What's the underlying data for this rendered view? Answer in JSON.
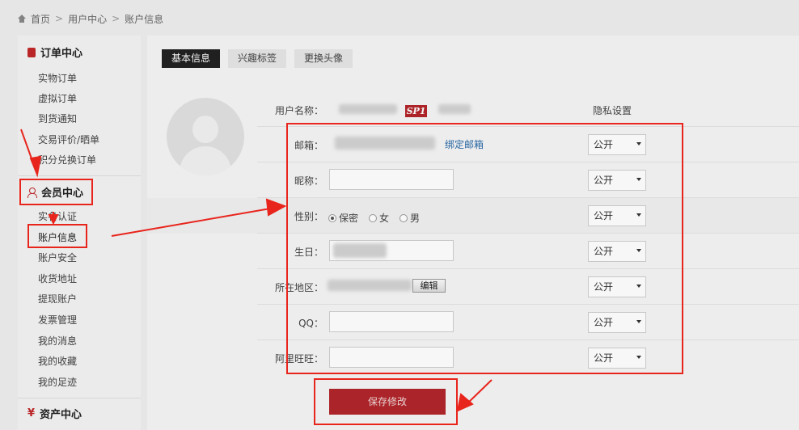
{
  "breadcrumb": {
    "home": "首页",
    "sep1": ">",
    "center": "用户中心",
    "sep2": ">",
    "current": "账户信息"
  },
  "sidebar": {
    "order_center": {
      "title": "订单中心",
      "items": [
        "实物订单",
        "虚拟订单",
        "到货通知",
        "交易评价/晒单",
        "积分兑换订单"
      ]
    },
    "member_center": {
      "title": "会员中心",
      "items": [
        "实名认证",
        "账户信息",
        "账户安全",
        "收货地址",
        "提现账户",
        "发票管理",
        "我的消息",
        "我的收藏",
        "我的足迹"
      ]
    },
    "asset_center": {
      "title": "资产中心"
    }
  },
  "tabs": [
    "基本信息",
    "兴趣标签",
    "更换头像"
  ],
  "form": {
    "username_label": "用户名称：",
    "sp_badge": "SP1",
    "privacy_header": "隐私设置",
    "email_label": "邮箱：",
    "bind_email_link": "绑定邮箱",
    "nickname_label": "昵称：",
    "gender_label": "性别：",
    "gender_options": [
      "保密",
      "女",
      "男"
    ],
    "gender_selected": "保密",
    "birthday_label": "生日：",
    "region_label": "所在地区：",
    "edit_button": "编辑",
    "qq_label": "QQ：",
    "wangwang_label": "阿里旺旺：",
    "privacy_values": [
      "公开",
      "公开",
      "公开",
      "公开",
      "公开",
      "公开",
      "公开"
    ],
    "save_button": "保存修改"
  },
  "colors": {
    "accent": "#c0282a",
    "annotation": "#e8251d",
    "link": "#2a6aa8"
  }
}
